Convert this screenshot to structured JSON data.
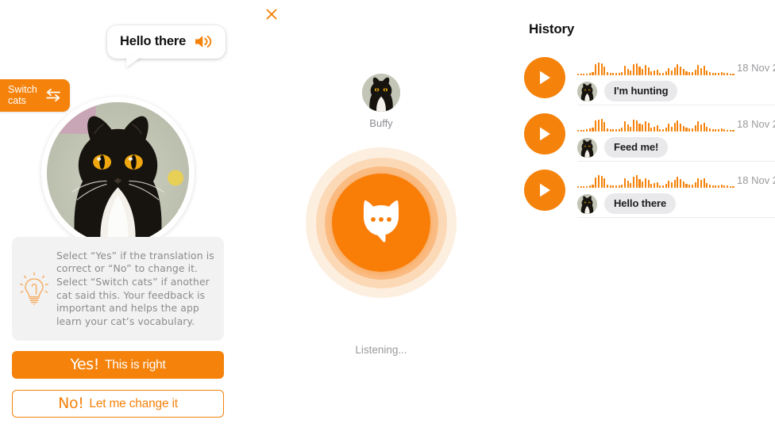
{
  "left": {
    "bubble": {
      "text": "Hello there",
      "speaker_icon": "speaker-icon"
    },
    "switch_cats": {
      "label_line1": "Switch",
      "label_line2": "cats",
      "icon": "swap-arrows-icon"
    },
    "cat_photo": {
      "alt": "tuxedo-cat-photo"
    },
    "tip": {
      "icon": "lightbulb-icon",
      "text": "Select “Yes” if the translation is correct or “No” to change it. Select “Switch cats” if another cat said this.  Your feedback is important and helps the app learn your cat’s vocabulary."
    },
    "buttons": {
      "yes_lead": "Yes!",
      "yes_rest": "This is right",
      "no_lead": "No!",
      "no_rest": "Let me change it"
    }
  },
  "center": {
    "close_icon": "close-icon",
    "cat_name": "Buffy",
    "mic_icon": "cat-speech-bubble-icon",
    "status": "Listening..."
  },
  "right": {
    "title": "History",
    "rows": [
      {
        "play_icon": "play-icon",
        "message": "I'm hunting",
        "date": "18 Nov 2",
        "wave": [
          2,
          2,
          2,
          2,
          3,
          4,
          14,
          16,
          15,
          11,
          4,
          3,
          3,
          3,
          3,
          4,
          12,
          8,
          6,
          14,
          15,
          11,
          8,
          13,
          10,
          5,
          6,
          7,
          3,
          3,
          5,
          9,
          6,
          10,
          14,
          11,
          8,
          5,
          4,
          4,
          7,
          13,
          9,
          12,
          6,
          4,
          3,
          3,
          3,
          4,
          3,
          3,
          2,
          2
        ]
      },
      {
        "play_icon": "play-icon",
        "message": "Feed me!",
        "date": "18 Nov 2",
        "wave": [
          2,
          2,
          2,
          3,
          4,
          5,
          14,
          15,
          16,
          12,
          4,
          3,
          3,
          3,
          3,
          5,
          13,
          9,
          6,
          15,
          14,
          10,
          9,
          13,
          11,
          5,
          6,
          8,
          3,
          3,
          5,
          10,
          6,
          11,
          14,
          10,
          7,
          5,
          4,
          4,
          8,
          13,
          9,
          11,
          6,
          4,
          3,
          3,
          3,
          4,
          3,
          2,
          2,
          2
        ]
      },
      {
        "play_icon": "play-icon",
        "message": "Hello there",
        "date": "18 Nov 2",
        "wave": [
          2,
          2,
          2,
          2,
          3,
          4,
          13,
          16,
          15,
          12,
          4,
          3,
          3,
          3,
          3,
          4,
          12,
          9,
          6,
          14,
          16,
          11,
          8,
          12,
          10,
          5,
          6,
          7,
          3,
          3,
          5,
          9,
          7,
          10,
          14,
          11,
          8,
          5,
          4,
          4,
          7,
          12,
          10,
          12,
          6,
          4,
          3,
          3,
          3,
          4,
          3,
          3,
          2,
          2
        ]
      }
    ]
  },
  "colors": {
    "accent": "#F5820B",
    "mic": "#F97E08",
    "pill_bg": "#e9e9eb",
    "tip_bg": "#f2f2f2",
    "muted_text": "#8e8e93"
  }
}
